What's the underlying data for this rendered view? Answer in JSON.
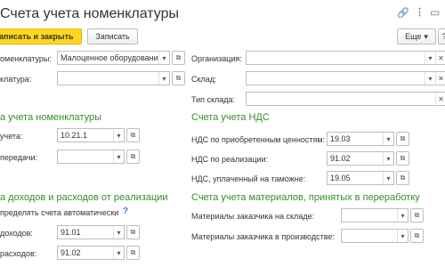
{
  "window": {
    "title": "Счета учета номенклатуры"
  },
  "header_icons": [
    "link-icon",
    "more-vertical-icon",
    "maximize-icon"
  ],
  "toolbar": {
    "save_close_label": "аписать и закрыть",
    "save_label": "Записать",
    "more_label": "Еще",
    "more_chevron": "▾",
    "help_label": "?"
  },
  "left_fields": {
    "nomenclature_label": "оменклатуры:",
    "nomenclature_value": "Малоценное оборудование",
    "nomenclature2_label": "клатура:",
    "nomenclature2_value": ""
  },
  "right_fields": {
    "organization_label": "Организация:",
    "organization_value": "",
    "warehouse_label": "Склад:",
    "warehouse_value": "",
    "warehouse_type_label": "Тип склада:",
    "warehouse_type_value": ""
  },
  "section_nomenclature": {
    "title": "а учета номенклатуры",
    "account_label": "учета:",
    "account_value": "10.21.1",
    "transfer_label": "передачи:",
    "transfer_value": ""
  },
  "section_vat": {
    "title": "Счета учета НДС",
    "acquired_label": "НДС по приобретенным ценностям:",
    "acquired_value": "19.03",
    "sales_label": "НДС по реализации:",
    "sales_value": "91.02",
    "customs_label": "НДС, уплаченный на таможне:",
    "customs_value": "19.05"
  },
  "section_income": {
    "title": "а доходов и расходов от реализации",
    "auto_label": "пределять счета автоматически",
    "auto_help": "?",
    "income_label": "доходов:",
    "income_value": "91.01",
    "expense_label": "расходов:",
    "expense_value": "91.02"
  },
  "section_materials": {
    "title": "Счета учета материалов, принятых в переработку",
    "warehouse_label": "Материалы заказчика на складе:",
    "warehouse_value": "",
    "production_label": "Материалы заказчика в производстве:",
    "production_value": ""
  }
}
